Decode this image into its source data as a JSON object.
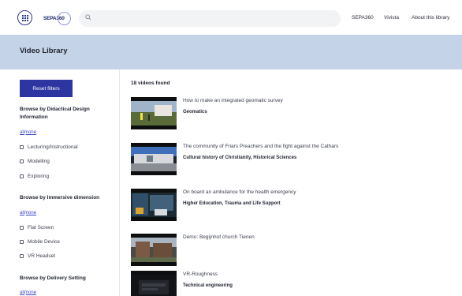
{
  "header": {
    "logo_text": "SEPA360",
    "search": {
      "placeholder": ""
    },
    "nav": [
      "SEPA360",
      "Vivista",
      "About this library"
    ]
  },
  "page": {
    "title": "Video Library"
  },
  "sidebar": {
    "reset_label": "Reset filters",
    "all_label": "all",
    "separator": "/",
    "none_label": "none",
    "groups": [
      {
        "title": "Browse by Didactical Design Information",
        "options": [
          "Lecturing/Instructional",
          "Modelling",
          "Exploring"
        ]
      },
      {
        "title": "Browse by Immersive dimension",
        "options": [
          "Flat Screen",
          "Mobile Device",
          "VR Headset"
        ]
      },
      {
        "title": "Browse by Delivery Setting",
        "options": []
      }
    ]
  },
  "results": {
    "count_text": "18 videos found",
    "items": [
      {
        "title": "How to make an integrated geomatic survey",
        "tags": "Geomatics"
      },
      {
        "title": "The community of Friars Preachers and the fight against the Cathars",
        "tags": "Cultural history of Christianity, Historical Sciences"
      },
      {
        "title": "On board an ambulance for the health emergency",
        "tags": "Higher Education, Trauma and Life Support"
      },
      {
        "title": "Demo: Begijnhof church Tienen",
        "tags": ""
      },
      {
        "title": "VR-Roughness",
        "tags": "Technical engineering"
      }
    ]
  },
  "colors": {
    "accent": "#2c35a0",
    "band": "#c5d3e8",
    "link": "#3a47c9"
  },
  "icons": {
    "apps": "apps-grid-icon",
    "search": "search-icon"
  }
}
